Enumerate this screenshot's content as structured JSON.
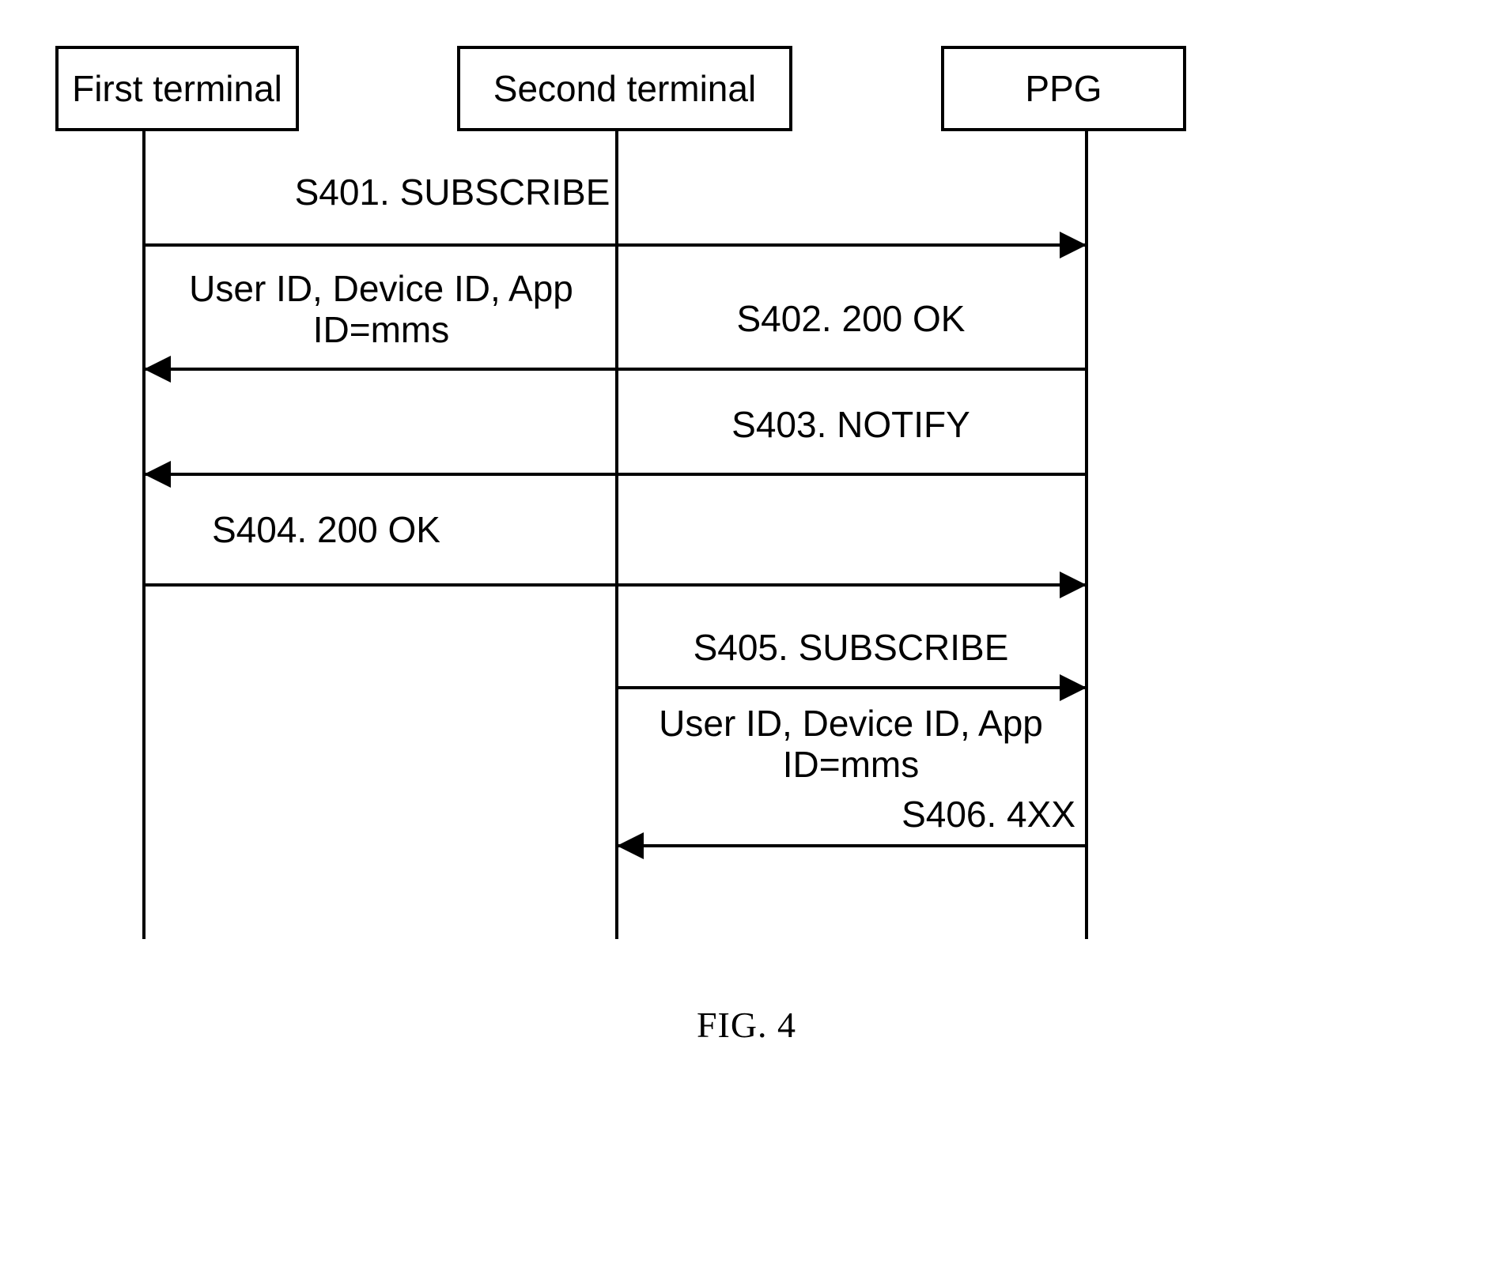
{
  "figure": {
    "caption": "FIG. 4",
    "type": "sequence-diagram"
  },
  "actors": [
    {
      "id": "first-terminal",
      "label": "First terminal"
    },
    {
      "id": "second-terminal",
      "label": "Second terminal"
    },
    {
      "id": "ppg",
      "label": "PPG"
    }
  ],
  "messages": [
    {
      "id": "s401",
      "label": "S401. SUBSCRIBE",
      "from": "first-terminal",
      "to": "ppg",
      "direction": "right"
    },
    {
      "id": "s402",
      "label": "User ID, Device ID, App\nID=mms",
      "label2": "S402. 200 OK",
      "from": "ppg",
      "to": "first-terminal",
      "direction": "left"
    },
    {
      "id": "s403",
      "label": "S403. NOTIFY",
      "from": "ppg",
      "to": "first-terminal",
      "direction": "left"
    },
    {
      "id": "s404",
      "label": "S404. 200 OK",
      "from": "first-terminal",
      "to": "ppg",
      "direction": "right"
    },
    {
      "id": "s405",
      "label": "S405. SUBSCRIBE",
      "from": "second-terminal",
      "to": "ppg",
      "direction": "right"
    },
    {
      "id": "s406",
      "label": "User ID, Device ID, App\nID=mms",
      "label2": "S406. 4XX",
      "from": "ppg",
      "to": "second-terminal",
      "direction": "left"
    }
  ],
  "colors": {
    "line": "#000000",
    "background": "#ffffff",
    "text": "#000000"
  }
}
